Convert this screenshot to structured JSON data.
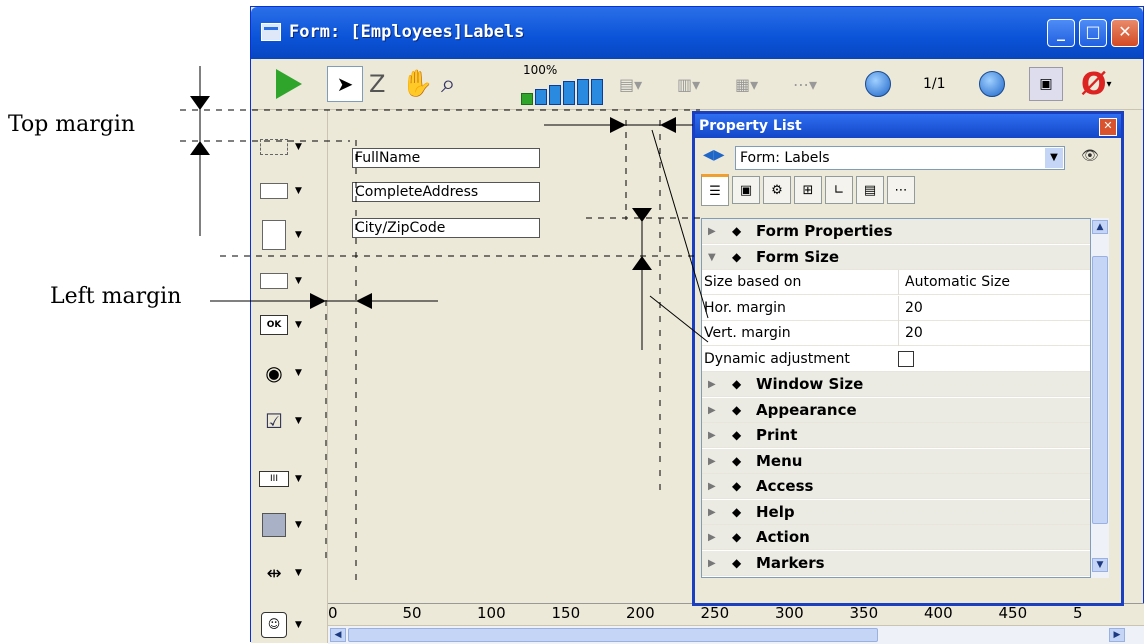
{
  "annotations": {
    "top_margin": "Top margin",
    "left_margin": "Left margin"
  },
  "window": {
    "title": "Form: [Employees]Labels",
    "zoom": "100%",
    "page_indicator": "1/1",
    "buttons": [
      "minimize",
      "maximize",
      "close"
    ]
  },
  "fields": [
    {
      "name": "FullName"
    },
    {
      "name": "CompleteAddress"
    },
    {
      "name": "City/ZipCode"
    }
  ],
  "ruler": {
    "ticks": [
      "0",
      "50",
      "100",
      "150",
      "200",
      "250",
      "300",
      "350",
      "400",
      "450",
      "5"
    ]
  },
  "palette": {
    "items": [
      "field-tool-icon",
      "line-tool-icon",
      "list-tool-icon",
      "combo-tool-icon",
      "ok-button-tool-icon",
      "radio-tool-icon",
      "checkbox-tool-icon",
      "progress-tool-icon",
      "rectangle-tool-icon",
      "splitter-tool-icon",
      "plugin-tool-icon"
    ],
    "ok_label": "OK"
  },
  "property_list": {
    "title": "Property List",
    "selected_object": "Form: Labels",
    "groups_before": [
      {
        "label": "Form Properties",
        "icon": "form-properties-icon"
      },
      {
        "label": "Form Size",
        "icon": "form-size-icon",
        "expanded": true
      }
    ],
    "properties": [
      {
        "name": "Size based on",
        "value": "Automatic Size"
      },
      {
        "name": "Hor. margin",
        "value": "20"
      },
      {
        "name": "Vert. margin",
        "value": "20"
      },
      {
        "name": "Dynamic adjustment",
        "value": "",
        "checkbox": false
      }
    ],
    "groups_after": [
      {
        "label": "Window Size",
        "icon": "window-size-icon"
      },
      {
        "label": "Appearance",
        "icon": "appearance-icon"
      },
      {
        "label": "Print",
        "icon": "print-icon"
      },
      {
        "label": "Menu",
        "icon": "menu-icon"
      },
      {
        "label": "Access",
        "icon": "access-icon"
      },
      {
        "label": "Help",
        "icon": "help-icon"
      },
      {
        "label": "Action",
        "icon": "action-icon"
      },
      {
        "label": "Markers",
        "icon": "markers-icon"
      }
    ],
    "tab_icons": [
      "objects-tab-icon",
      "display-tab-icon",
      "settings-tab-icon",
      "entry-tab-icon",
      "chart-tab-icon",
      "events-tab-icon",
      "more-tab-icon"
    ]
  }
}
